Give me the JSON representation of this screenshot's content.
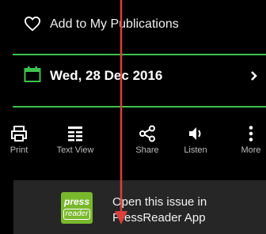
{
  "favorites": {
    "label": "Add to My Publications",
    "icon": "heart-outline-icon"
  },
  "issue_date": {
    "label": "Wed, 28 Dec 2016",
    "icon": "calendar-icon",
    "chevron_icon": "chevron-right-icon"
  },
  "toolbar": {
    "items": [
      {
        "label": "Print",
        "icon": "printer-icon"
      },
      {
        "label": "Text View",
        "icon": "text-view-icon"
      },
      {
        "label": "Share",
        "icon": "share-icon"
      },
      {
        "label": "Listen",
        "icon": "speaker-icon"
      },
      {
        "label": "More",
        "icon": "more-vertical-icon"
      }
    ]
  },
  "open_in_app": {
    "line1": "Open this issue in",
    "line2": "PressReader App",
    "logo_top": "press",
    "logo_bottom": "reader"
  },
  "colors": {
    "accent_green": "#3fc14e",
    "logo_green": "#79b82c",
    "annotation_arrow": "#d9403a",
    "bar_background": "#262626"
  }
}
